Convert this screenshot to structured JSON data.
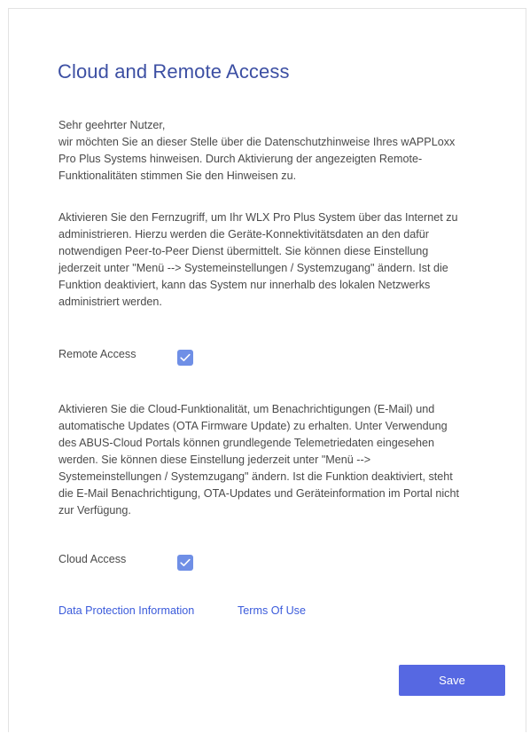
{
  "dialog": {
    "title": "Cloud and Remote Access",
    "intro": {
      "lines": [
        "Sehr geehrter Nutzer,",
        "wir möchten Sie an dieser Stelle über die Datenschutzhinweise Ihres wAPPLoxx",
        "Pro Plus Systems hinweisen. Durch Aktivierung der angezeigten Remote-",
        "Funktionalitäten stimmen Sie den Hinweisen zu."
      ]
    },
    "remote_info": {
      "lines": [
        "Aktivieren Sie den Fernzugriff, um Ihr WLX Pro Plus System über das Internet zu",
        "administrieren. Hierzu werden die Geräte-Konnektivitätsdaten an den dafür",
        "notwendigen Peer-to-Peer Dienst übermittelt. Sie können diese Einstellung",
        "jederzeit unter \"Menü --> Systemeinstellungen / Systemzugang\" ändern. Ist die",
        "Funktion deaktiviert, kann das System nur innerhalb des lokalen Netzwerks",
        "administriert werden."
      ]
    },
    "remote_access": {
      "label": "Remote Access",
      "checked": true
    },
    "cloud_info": {
      "lines": [
        "Aktivieren Sie die  Cloud-Funktionalität, um Benachrichtigungen (E-Mail) und",
        "automatische Updates (OTA Firmware Update) zu erhalten. Unter Verwendung",
        "des ABUS-Cloud Portals können grundlegende Telemetriedaten eingesehen",
        "werden. Sie können diese Einstellung jederzeit unter \"Menü -->",
        "Systemeinstellungen / Systemzugang\" ändern. Ist die Funktion deaktiviert, steht",
        "die E-Mail Benachrichtigung, OTA-Updates und Geräteinformation im Portal nicht",
        "zur Verfügung."
      ]
    },
    "cloud_access": {
      "label": "Cloud Access",
      "checked": true
    },
    "links": {
      "data_protection": "Data Protection Information",
      "terms_of_use": "Terms Of Use"
    },
    "save_label": "Save"
  },
  "colors": {
    "title": "#3c4fa3",
    "checkbox": "#6f8fe6",
    "link": "#3b5bdb",
    "button": "#5668e2"
  },
  "icons": {
    "checkbox_check": "check-icon"
  }
}
